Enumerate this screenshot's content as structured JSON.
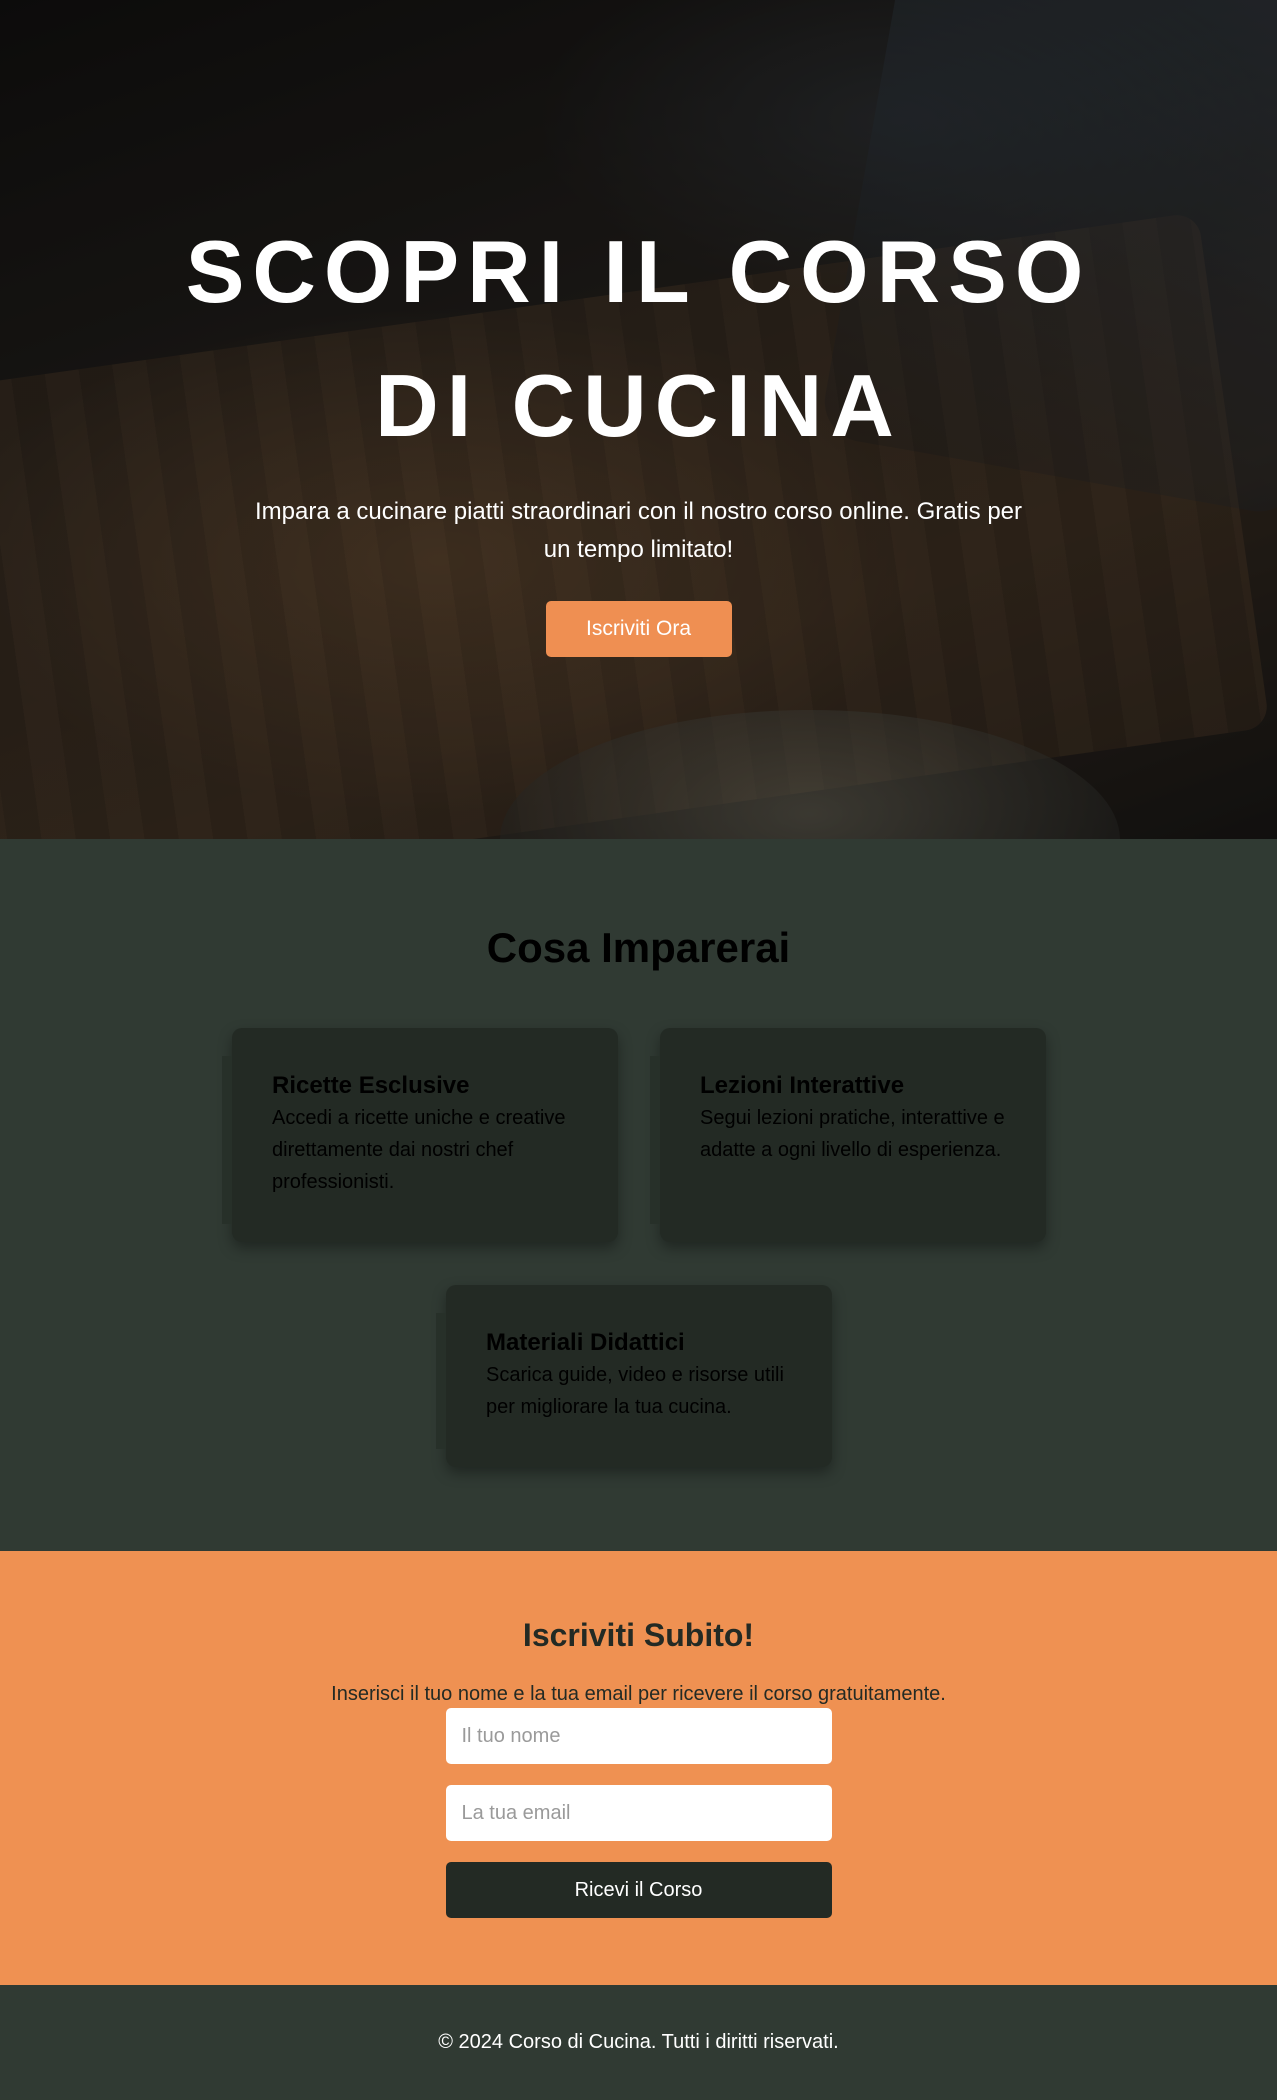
{
  "hero": {
    "title": "SCOPRI IL CORSO DI CUCINA",
    "subtitle": "Impara a cucinare piatti straordinari con il nostro corso online. Gratis per un tempo limitato!",
    "cta_label": "Iscriviti Ora"
  },
  "features": {
    "title": "Cosa Imparerai",
    "cards": [
      {
        "title": "Ricette Esclusive",
        "text": "Accedi a ricette uniche e creative direttamente dai nostri chef professionisti."
      },
      {
        "title": "Lezioni Interattive",
        "text": "Segui lezioni pratiche, interattive e adatte a ogni livello di esperienza."
      },
      {
        "title": "Materiali Didattici",
        "text": "Scarica guide, video e risorse utili per migliorare la tua cucina."
      }
    ]
  },
  "signup": {
    "title": "Iscriviti Subito!",
    "lead": "Inserisci il tuo nome e la tua email per ricevere il corso gratuitamente.",
    "name_placeholder": "Il tuo nome",
    "email_placeholder": "La tua email",
    "submit_label": "Ricevi il Corso"
  },
  "footer": {
    "text": "© 2024 Corso di Cucina. Tutti i diritti riservati."
  },
  "colors": {
    "accent": "#ef9152",
    "dark_green": "#303a33",
    "card_bg": "#232a24"
  }
}
